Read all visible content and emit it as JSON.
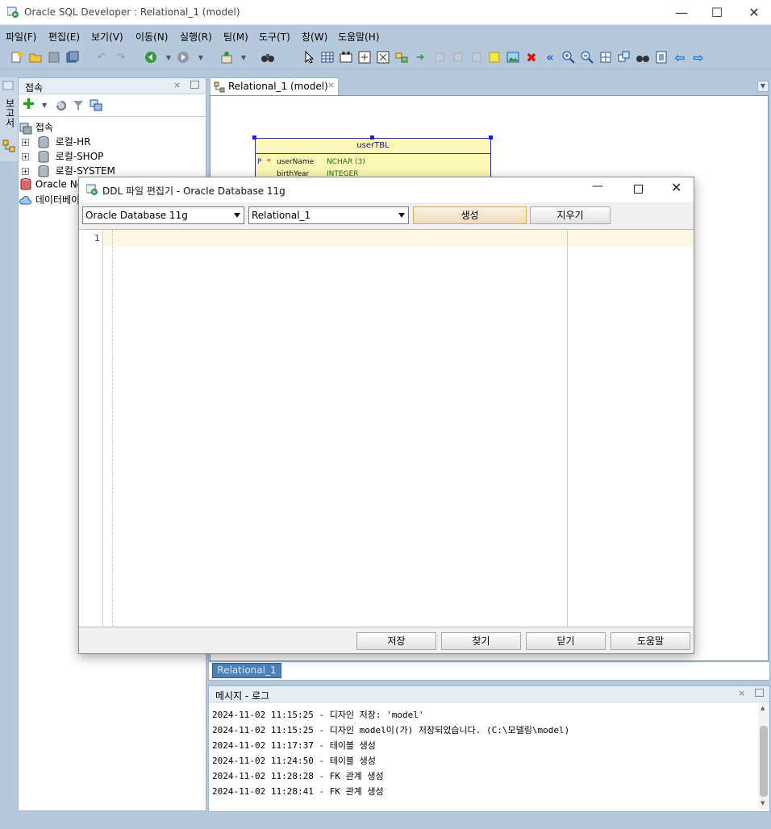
{
  "window": {
    "title": "Oracle SQL Developer : Relational_1 (model)"
  },
  "menubar": [
    "파일(F)",
    "편집(E)",
    "보기(V)",
    "이동(N)",
    "실행(R)",
    "팀(M)",
    "도구(T)",
    "창(W)",
    "도움말(H)"
  ],
  "left_strip": {
    "label": "보고서"
  },
  "connections_panel": {
    "title": "접속",
    "root": "접속",
    "items": [
      "로컬-HR",
      "로컬-SHOP",
      "로컬-SYSTEM"
    ],
    "extra_items": [
      "Oracle No",
      "데이터베이"
    ]
  },
  "editor": {
    "tab_label": "Relational_1 (model)",
    "entity": {
      "name": "userTBL",
      "columns": [
        {
          "key": "P",
          "flag": "*",
          "name": "userName",
          "type": "NCHAR (3)"
        },
        {
          "key": "",
          "flag": "",
          "name": "birthYear",
          "type": "INTEGER"
        }
      ]
    },
    "diagram_tab": "Relational_1"
  },
  "ddl_dialog": {
    "title": "DDL 파일 편집기 - Oracle Database 11g",
    "db_select": "Oracle Database 11g",
    "model_select": "Relational_1",
    "generate_button": "생성",
    "clear_button": "지우기",
    "line_number": "1",
    "footer_buttons": [
      "저장",
      "찾기",
      "닫기",
      "도움말"
    ]
  },
  "log_panel": {
    "title": "메시지 - 로그",
    "lines": [
      "2024-11-02 11:15:25 - 디자인 저장: 'model'",
      "2024-11-02 11:15:25 - 디자인 model이(가) 저장되었습니다. (C:\\모델링\\model)",
      "2024-11-02 11:17:37 - 테이블 생성",
      "2024-11-02 11:24:50 - 테이블 생성",
      "2024-11-02 11:28:28 - FK 관계 생성",
      "2024-11-02 11:28:41 - FK 관계 생성"
    ]
  }
}
